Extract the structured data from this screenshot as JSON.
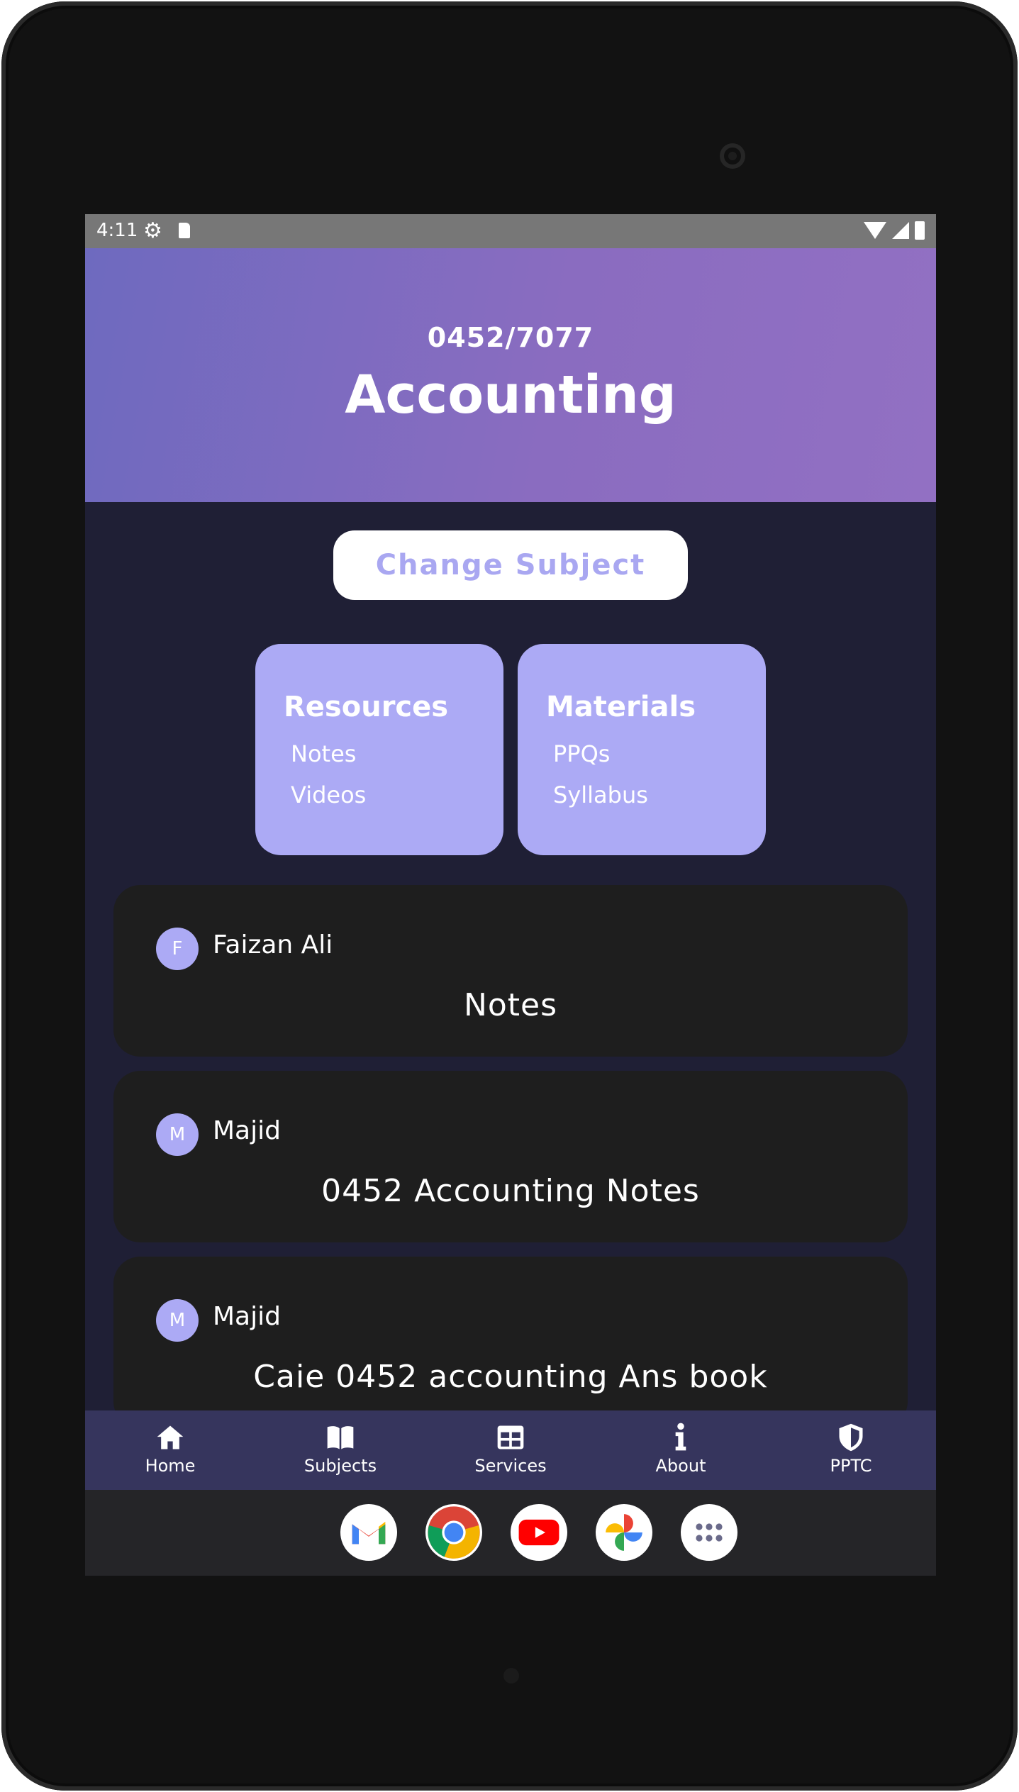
{
  "status_bar": {
    "time": "4:11"
  },
  "header": {
    "subject_code": "0452/7077",
    "subject_name": "Accounting"
  },
  "change_subject": {
    "label": "Change Subject"
  },
  "tiles": [
    {
      "title": "Resources",
      "links": [
        "Notes",
        "Videos"
      ]
    },
    {
      "title": "Materials",
      "links": [
        "PPQs",
        "Syllabus"
      ]
    }
  ],
  "posts": [
    {
      "avatar_letter": "F",
      "author": "Faizan Ali",
      "title": "Notes"
    },
    {
      "avatar_letter": "M",
      "author": "Majid",
      "title": "0452 Accounting Notes"
    },
    {
      "avatar_letter": "M",
      "author": "Majid",
      "title": "Caie 0452 accounting Ans book"
    }
  ],
  "nav": [
    {
      "label": "Home",
      "icon": "home-icon"
    },
    {
      "label": "Subjects",
      "icon": "book-icon"
    },
    {
      "label": "Services",
      "icon": "grid-icon"
    },
    {
      "label": "About",
      "icon": "info-icon"
    },
    {
      "label": "PPTC",
      "icon": "shield-icon"
    }
  ],
  "dock": [
    "gmail-icon",
    "chrome-icon",
    "youtube-icon",
    "photos-icon",
    "app-drawer-icon"
  ],
  "colors": {
    "accent": "#acaaf5",
    "header_start": "#6e6abf",
    "header_end": "#9270c3",
    "background": "#1f1f35",
    "card": "#1e1e1e",
    "navbar": "#36355d"
  }
}
